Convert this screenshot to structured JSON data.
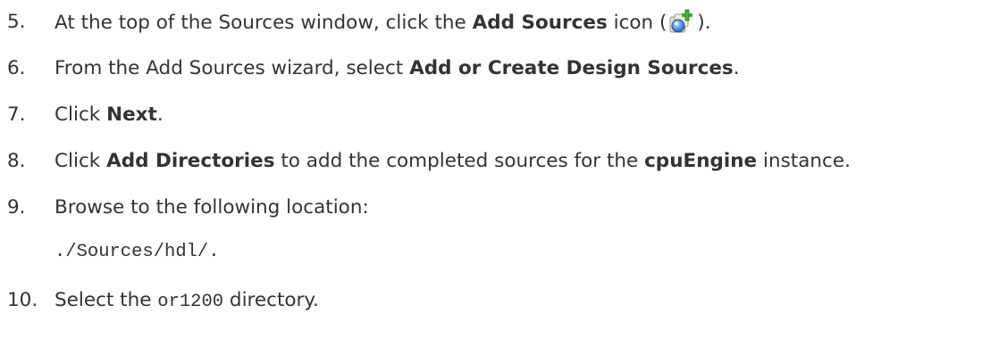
{
  "steps": [
    {
      "num": "5.",
      "parts": [
        "At the top of the Sources window, click the ",
        "Add Sources",
        " icon (",
        ")."
      ]
    },
    {
      "num": "6.",
      "parts": [
        "From the Add Sources wizard, select ",
        "Add or Create Design Sources",
        "."
      ]
    },
    {
      "num": "7.",
      "parts": [
        "Click ",
        "Next",
        "."
      ]
    },
    {
      "num": "8.",
      "parts": [
        "Click ",
        "Add Directories",
        " to add the completed sources for the ",
        "cpuEngine",
        " instance."
      ]
    },
    {
      "num": "9.",
      "parts": [
        "Browse to the following location:"
      ],
      "path": "./Sources/hdl/."
    },
    {
      "num": "10.",
      "parts": [
        "Select the ",
        "or1200",
        " directory."
      ]
    }
  ],
  "icons": {
    "add_sources": "add-sources-icon"
  },
  "colors": {
    "text": "#333333",
    "icon_blue": "#3d7fd6",
    "icon_green": "#3fb23a"
  }
}
